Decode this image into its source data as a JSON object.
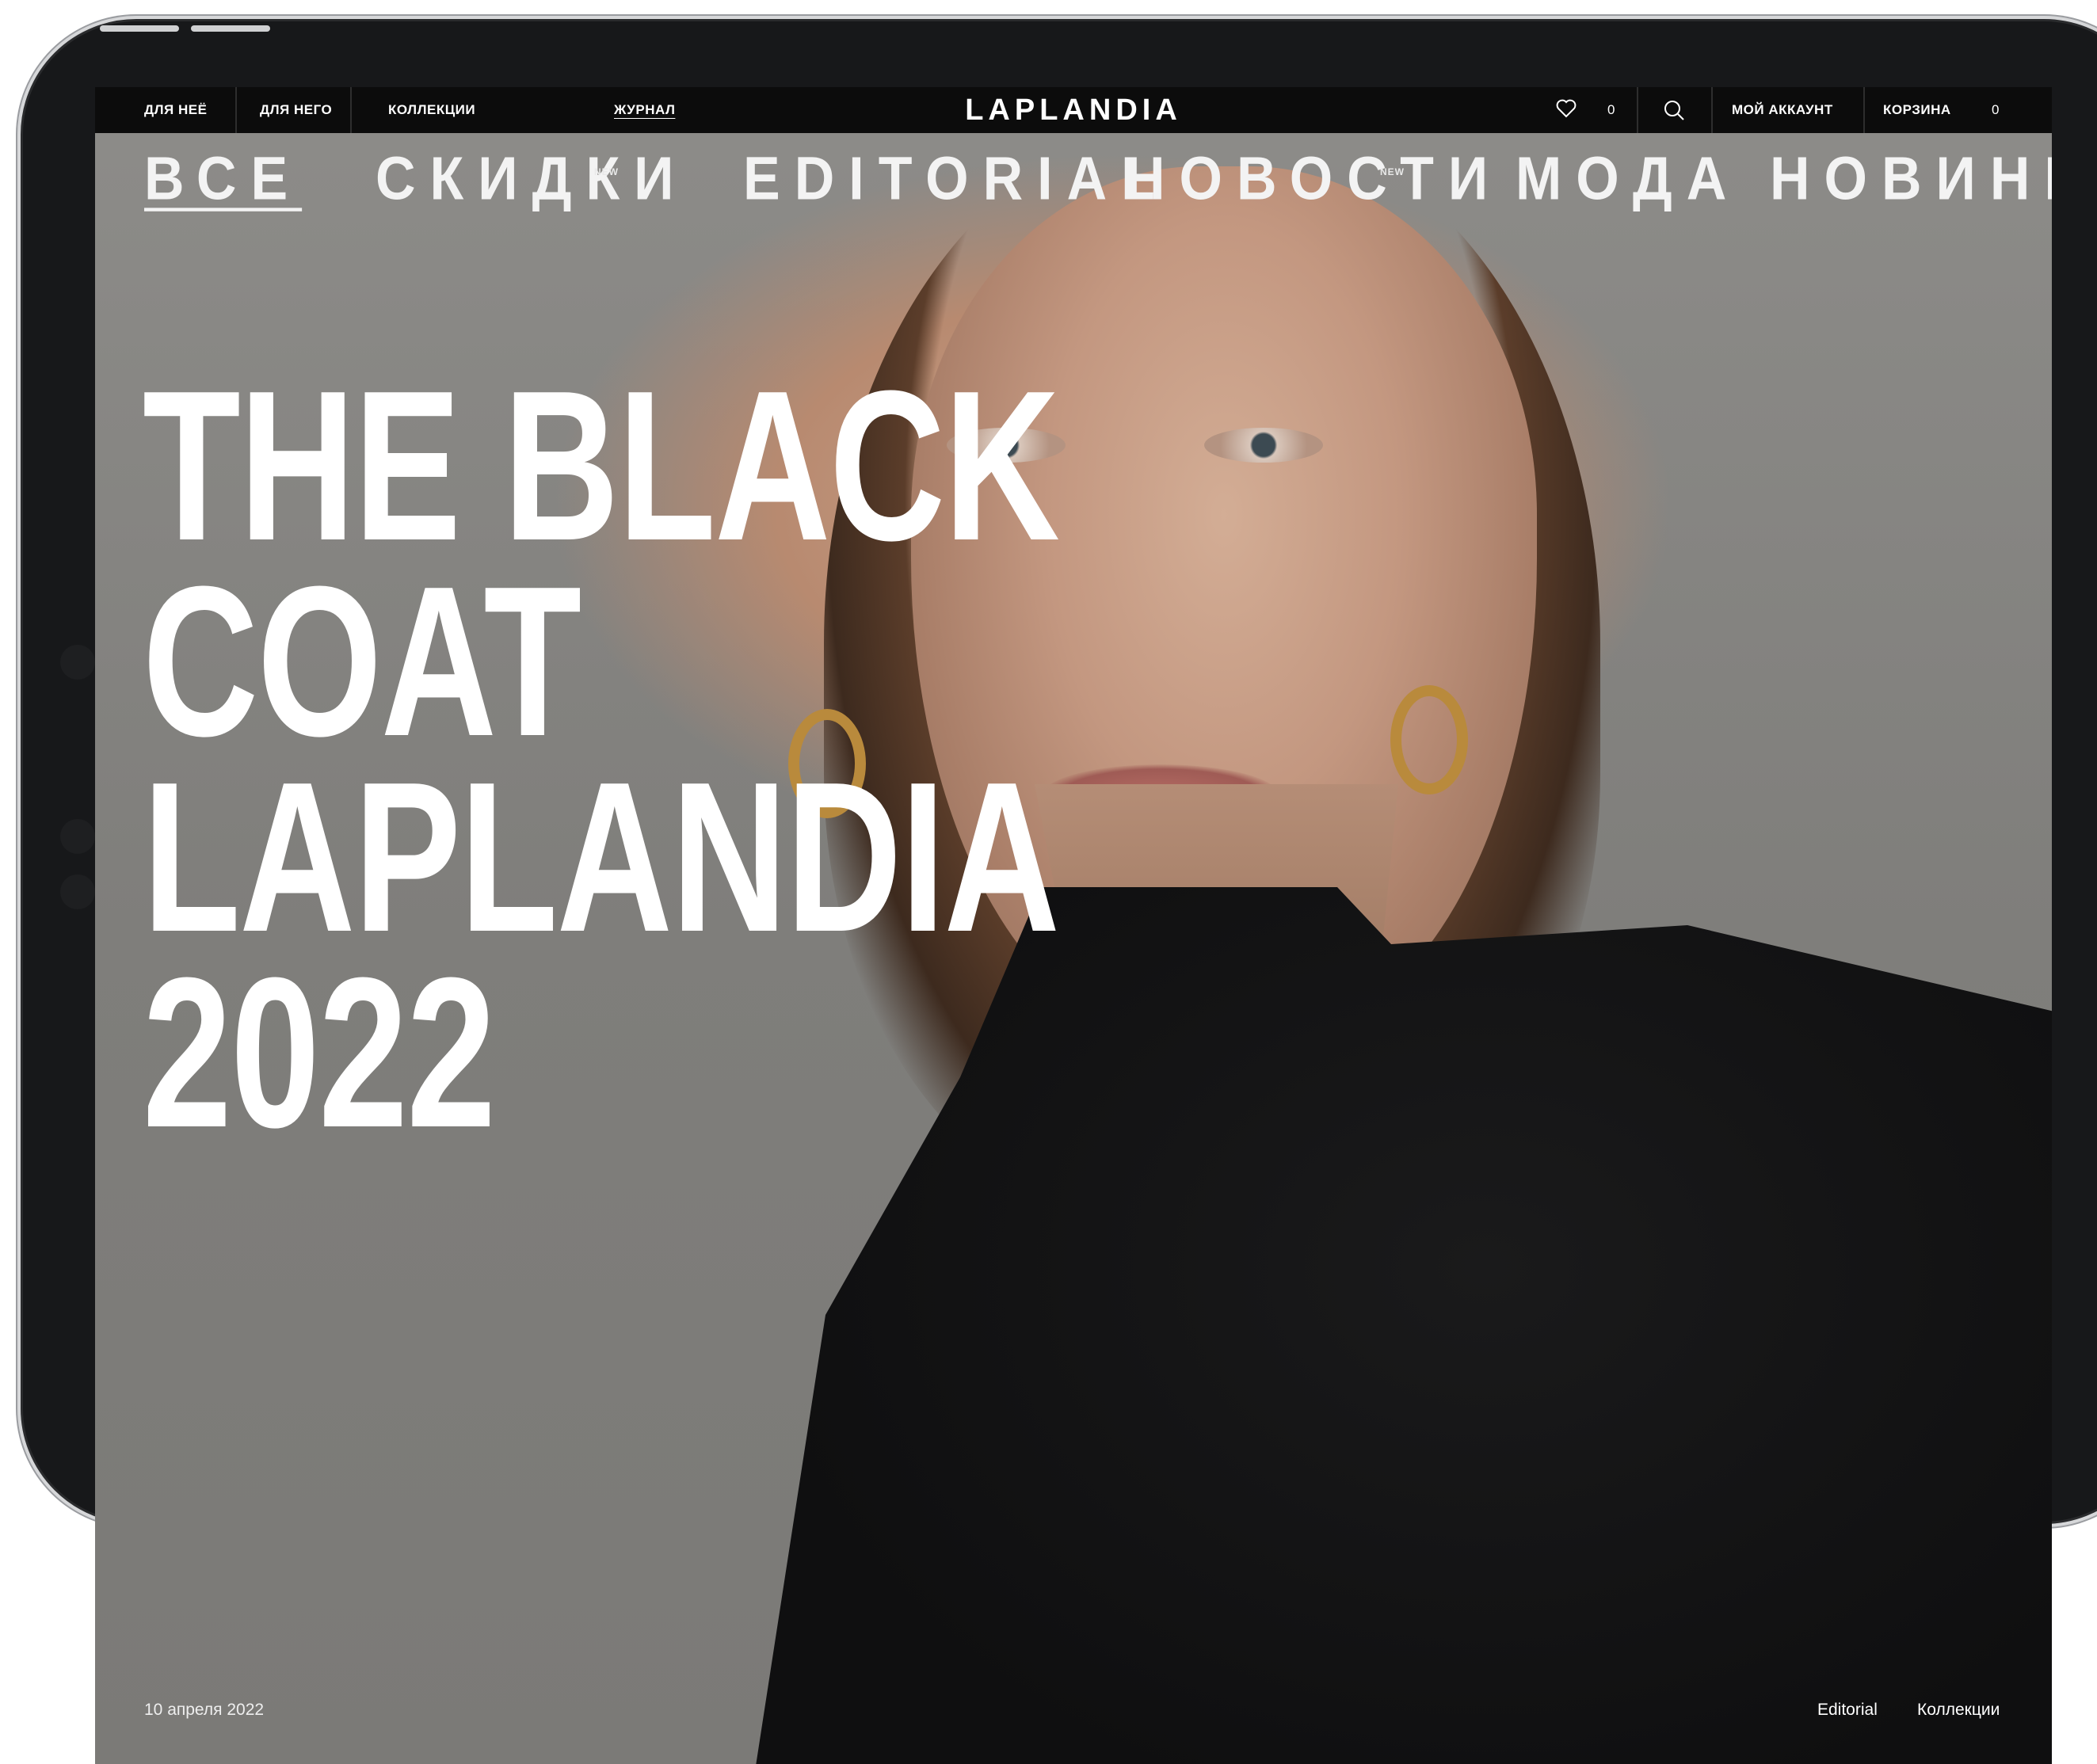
{
  "topbar": {
    "left_links": [
      "ДЛЯ НЕЁ",
      "ДЛЯ НЕГО",
      "КОЛЛЕКЦИИ",
      "ЖУРНАЛ"
    ],
    "active_link": "ЖУРНАЛ",
    "logo": "LAPLANDIA",
    "wishlist_icon": "heart-icon",
    "wishlist_count": "0",
    "search_icon": "search-icon",
    "account": "МОЙ АККАУНТ",
    "cart": "КОРЗИНА",
    "cart_count": "0"
  },
  "category_nav": {
    "items": [
      "ВСЕ",
      "СКИДКИ",
      "EDITORIAL",
      "НОВОСТИ",
      "МОДА",
      "НОВИНКИ"
    ],
    "selected": "ВСЕ",
    "new_badge": "NEW"
  },
  "hero": {
    "headline_lines": [
      "THE BLACK",
      "COAT",
      "LAPLANDIA",
      "2022"
    ]
  },
  "footer": {
    "date": "10 апреля 2022",
    "tags": [
      "Editorial",
      "Коллекции"
    ]
  },
  "colors": {
    "topbar_bg": "#0c0c0c",
    "hero_bg": "#8a8986",
    "text": "#ffffff"
  }
}
